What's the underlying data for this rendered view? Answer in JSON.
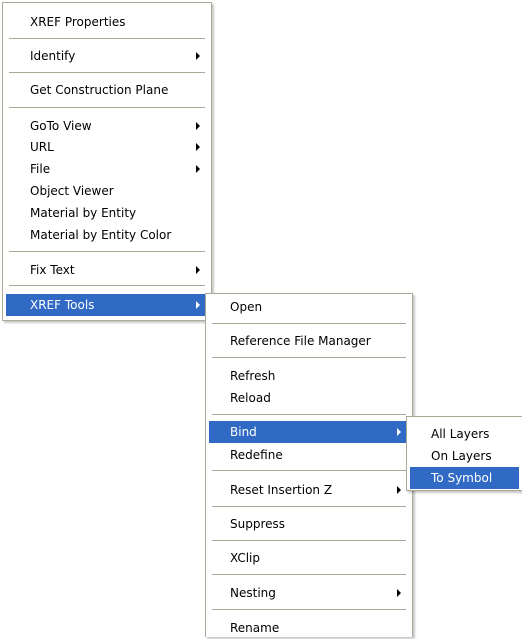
{
  "main_menu": {
    "xref_properties": "XREF Properties",
    "identify": "Identify",
    "get_construction_plane": "Get Construction Plane",
    "goto_view": "GoTo View",
    "url": "URL",
    "file": "File",
    "object_viewer": "Object Viewer",
    "material_by_entity": "Material by Entity",
    "material_by_entity_color": "Material by Entity Color",
    "fix_text": "Fix Text",
    "xref_tools": "XREF Tools"
  },
  "xref_tools_menu": {
    "open": "Open",
    "reference_file_manager": "Reference File Manager",
    "refresh": "Refresh",
    "reload": "Reload",
    "bind": "Bind",
    "redefine": "Redefine",
    "reset_insertion_z": "Reset Insertion Z",
    "suppress": "Suppress",
    "xclip": "XClip",
    "nesting": "Nesting",
    "rename": "Rename"
  },
  "bind_menu": {
    "all_layers": "All Layers",
    "on_layers": "On Layers",
    "to_symbol": "To Symbol"
  },
  "colors": {
    "highlight": "#316ac5",
    "highlight_text": "#ffffff",
    "separator": "#aca899",
    "menu_background": "#ffffff"
  }
}
